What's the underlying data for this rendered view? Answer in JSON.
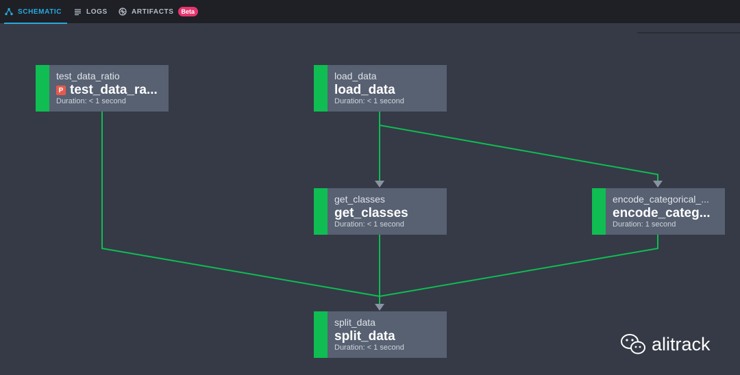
{
  "tabs": [
    {
      "label": "SCHEMATIC",
      "icon": "schematic-icon",
      "active": true
    },
    {
      "label": "LOGS",
      "icon": "logs-icon",
      "active": false
    },
    {
      "label": "ARTIFACTS",
      "icon": "artifacts-icon",
      "active": false,
      "badge": "Beta"
    }
  ],
  "nodes": {
    "test_data_ratio": {
      "sub": "test_data_ratio",
      "main": "test_data_ra...",
      "badge": "P",
      "duration": "Duration: < 1 second"
    },
    "load_data": {
      "sub": "load_data",
      "main": "load_data",
      "duration": "Duration: < 1 second"
    },
    "get_classes": {
      "sub": "get_classes",
      "main": "get_classes",
      "duration": "Duration: < 1 second"
    },
    "encode_categorical": {
      "sub": "encode_categorical_...",
      "main": "encode_categ...",
      "duration": "Duration: 1 second"
    },
    "split_data": {
      "sub": "split_data",
      "main": "split_data",
      "duration": "Duration: < 1 second"
    }
  },
  "colors": {
    "success": "#0fbd53",
    "accent": "#2aa9e0",
    "beta": "#e8356f",
    "background": "#353a46"
  },
  "watermark": {
    "text": "alitrack",
    "icon": "wechat-icon"
  }
}
